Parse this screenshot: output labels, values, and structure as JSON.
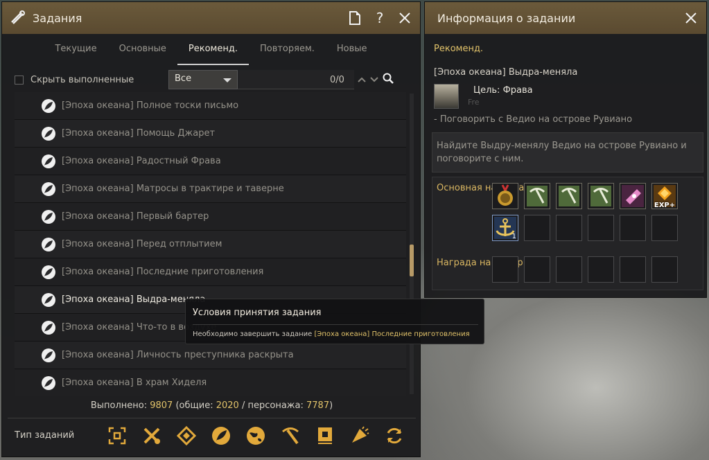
{
  "quest_window": {
    "title": "Задания",
    "tabs": [
      {
        "label": "Текущие"
      },
      {
        "label": "Основные"
      },
      {
        "label": "Рекоменд."
      },
      {
        "label": "Повторяем."
      },
      {
        "label": "Новые"
      }
    ],
    "active_tab": "Рекоменд.",
    "hide_completed_label": "Скрыть выполненные",
    "filter_selected": "Все",
    "search_counter": "0/0",
    "quests": [
      {
        "name": "[Эпоха океана] Полное тоски письмо"
      },
      {
        "name": "[Эпоха океана] Помощь Джарет"
      },
      {
        "name": "[Эпоха океана] Радостный Фрава"
      },
      {
        "name": "[Эпоха океана] Матросы в трактире и таверне"
      },
      {
        "name": "[Эпоха океана] Первый бартер"
      },
      {
        "name": "[Эпоха океана] Перед отплытием"
      },
      {
        "name": "[Эпоха океана] Последние приготовления"
      },
      {
        "name": "[Эпоха океана] Выдра-меняла"
      },
      {
        "name": "[Эпоха океана] Что-то в воздухе"
      },
      {
        "name": "[Эпоха океана] Личность преступника раскрыта"
      },
      {
        "name": "[Эпоха океана] В храм Хиделя"
      }
    ],
    "completed": {
      "prefix": "Выполнено:",
      "total": "9807",
      "general_label": "(общие:",
      "general": "2020",
      "char_label": "/ персонажа:",
      "character": "7787",
      "suffix": ")"
    },
    "type_label": "Тип заданий",
    "type_icons": [
      "all-icon",
      "tools-icon",
      "diamond-icon",
      "leaf-icon",
      "globe-icon",
      "pickaxe-icon",
      "book-icon",
      "horn-icon",
      "refresh-icon"
    ]
  },
  "info_window": {
    "title": "Информация о задании",
    "category": "Рекоменд.",
    "quest_title": "[Эпоха океана] Выдра-меняла",
    "target": "Цель: Фрава",
    "npc_sub": "Fre",
    "objective": "- Поговорить с Ведио на острове Рувиано",
    "description": "Найдите Выдру-менялу Ведио на острове Рувиано и поговорите с ним.",
    "main_reward_label": "Основная награда",
    "choice_reward_label": "Награда на выбор",
    "main_reward_items": [
      {
        "icon": "medal-icon",
        "qty": ""
      },
      {
        "icon": "green-tool-icon",
        "qty": ""
      },
      {
        "icon": "green-tool-icon",
        "qty": ""
      },
      {
        "icon": "green-tool-icon",
        "qty": ""
      },
      {
        "icon": "pink-card-icon",
        "qty": ""
      },
      {
        "icon": "exp-icon",
        "qty": "EXP+"
      },
      {
        "icon": "anchor-icon",
        "qty": "1"
      }
    ]
  },
  "tooltip": {
    "title": "Условия принятия задания",
    "text_prefix": "Необходимо завершить задание",
    "text_highlight": "[Эпоха океана] Последние приготовления"
  },
  "colors": {
    "accent_gold": "#e2c36a",
    "titlebar": "#6b5a3b"
  }
}
